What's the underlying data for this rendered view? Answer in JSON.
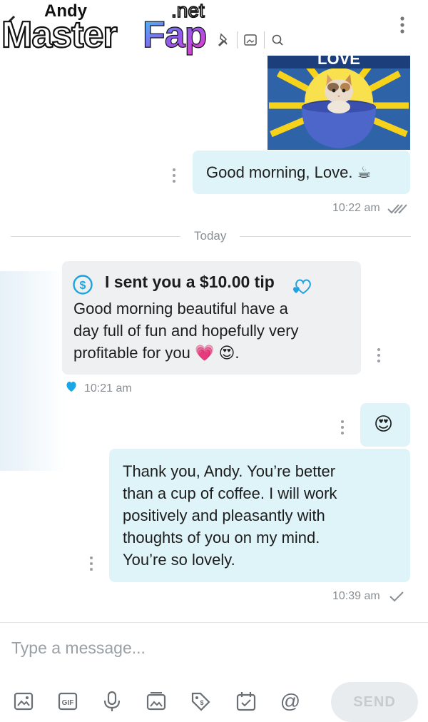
{
  "header": {
    "contact_name": "Andy",
    "watermark": "MasterFap",
    "watermark_tld": ".net",
    "icons": [
      "back-arrow-icon",
      "pin-icon",
      "image-icon",
      "search-icon",
      "more-vert-icon"
    ]
  },
  "messages": [
    {
      "id": "kitten",
      "type": "image",
      "direction": "outgoing",
      "caption_partial": "LOVE"
    },
    {
      "id": "morning",
      "direction": "outgoing",
      "text": "Good morning, Love. ☕",
      "time": "10:22 am",
      "status": "read"
    },
    {
      "id": "divider",
      "label": "Today"
    },
    {
      "id": "tip",
      "direction": "incoming",
      "tip_line": "I sent you a $10.00 tip",
      "text": "Good morning beautiful have a\nday full of fun and hopefully very\nprofitable for you 💗 😍.",
      "time": "10:21 am"
    },
    {
      "id": "emoji-only",
      "direction": "outgoing",
      "text": "😍"
    },
    {
      "id": "thanks",
      "direction": "outgoing",
      "text": "Thank you, Andy. You’re better\nthan a cup of coffee. I will work\npositively and pleasantly with\nthoughts of you on my mind.\nYou’re so lovely.",
      "time": "10:39 am",
      "status": "sent"
    }
  ],
  "composer": {
    "placeholder": "Type a message...",
    "send_label": "SEND",
    "tools": [
      "image-icon",
      "gif-icon",
      "microphone-icon",
      "media-icon",
      "price-tag-icon",
      "schedule-icon",
      "mention-icon"
    ]
  },
  "colors": {
    "outgoing_bubble": "#dff4f9",
    "incoming_bubble": "#eff0f1",
    "accent": "#00aff0",
    "meta_text": "#8a8f94"
  }
}
